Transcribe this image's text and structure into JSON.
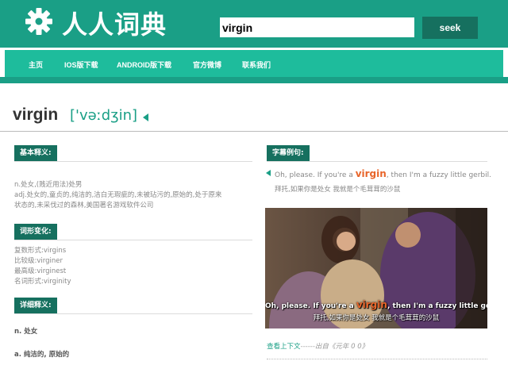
{
  "header": {
    "logo_text": "人人词典",
    "search_value": "virgin",
    "seek_label": "seek"
  },
  "nav": {
    "items": [
      "主页",
      "IOS版下载",
      "ANDROID版下载",
      "官方微博",
      "联系我们"
    ]
  },
  "entry": {
    "word": "virgin",
    "phonetic": "['vəːdʒin]"
  },
  "basic": {
    "heading": "基本释义:",
    "line1": "n.处女,(贱近用法)处男",
    "line2": "adj.处女的,童贞的,纯洁的,洁白无瑕疵的,未被玷污的,原始的,处于原来",
    "line3": "状态的,未采伐过的森林,美国著名游戏软件公司"
  },
  "forms": {
    "heading": "词形变化:",
    "items": [
      "复数形式:virgins",
      "比较级:virginer",
      "最高级:virginest",
      "名词形式:virginity"
    ]
  },
  "detail": {
    "heading": "详细释义:",
    "items": [
      "n. 处女",
      "a. 纯洁的, 原始的"
    ]
  },
  "examples": {
    "heading": "字幕例句:",
    "en_before": "Oh, please. If you're a ",
    "keyword": "virgin",
    "en_after": ", then I'm a fuzzy little gerbil.",
    "zh": "拜托,如果你是处女 我就是个毛茸茸的沙鼠",
    "still_en_before": "Oh, please. If you're a ",
    "still_keyword": "virgin",
    "still_en_after": ", then I'm a fuzzy little gerbil.",
    "still_zh": "拜托,如果你是处女 我就是个毛茸茸的沙鼠",
    "context_link": "查看上下文",
    "context_dashes": "------",
    "context_source": "出自《元年 0 0》"
  },
  "colors": {
    "brand": "#1a9f86",
    "nav": "#1ebc9c",
    "tag": "#16705f",
    "keyword": "#e8652a"
  }
}
